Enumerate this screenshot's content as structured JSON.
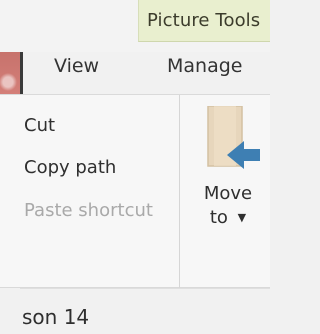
{
  "ribbon": {
    "context_tab": "Picture Tools",
    "tabs": {
      "view": "View",
      "manage": "Manage"
    },
    "commands": {
      "cut": "Cut",
      "copy_path": "Copy path",
      "paste_shortcut": "Paste shortcut"
    },
    "move_to": {
      "line1": "Move",
      "line2": "to"
    }
  },
  "status": {
    "bottom_text": "son 14"
  }
}
